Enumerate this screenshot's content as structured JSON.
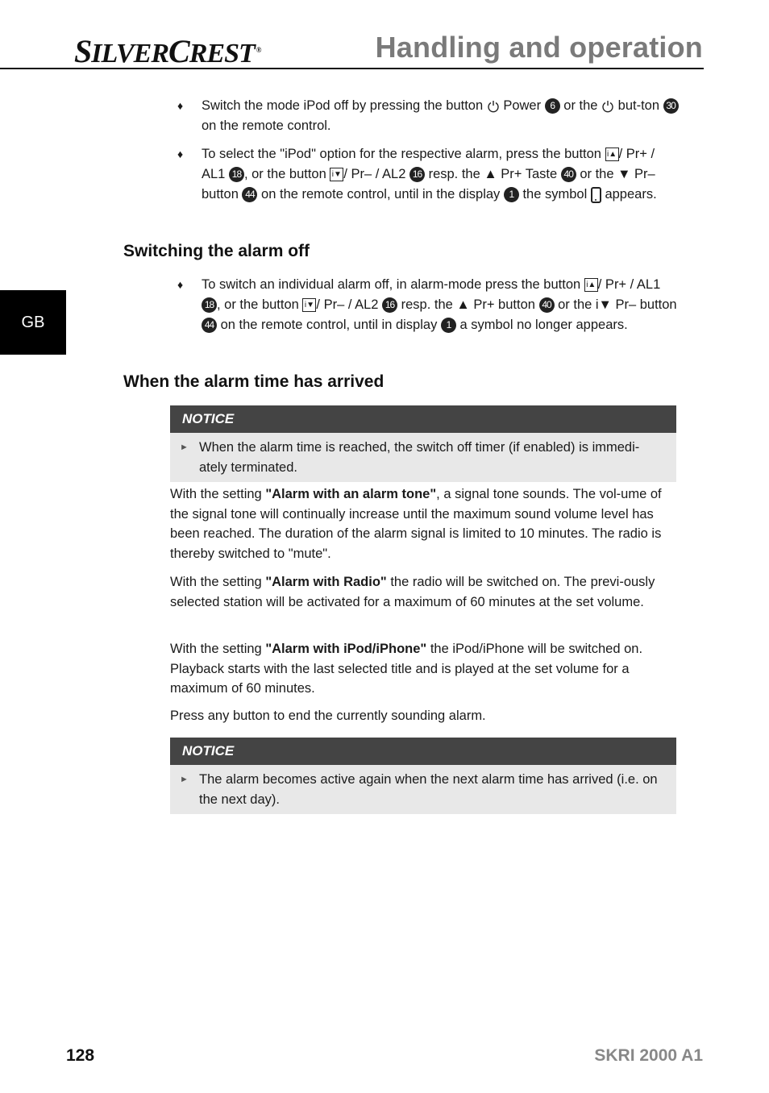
{
  "header": {
    "brand": "SilverCrest",
    "brand_parts": [
      "S",
      "ILVER",
      "C",
      "REST"
    ],
    "registered_mark": "®",
    "title": "Handling and operation"
  },
  "side_tab": {
    "label": "GB"
  },
  "intro_bullets": [
    {
      "marker": "♦",
      "segments": {
        "a": "Switch the mode iPod off by pressing the button ",
        "b": " Power ",
        "num1": "6",
        "c": " or the ",
        "d": " but-ton ",
        "num2": "30",
        "e": " on the remote control."
      }
    },
    {
      "marker": "♦",
      "segments": {
        "a": "To select the \"iPod\" option for the respective alarm, press the button ",
        "b": "/ Pr+ / AL1 ",
        "num1": "18",
        "c": ", or the button ",
        "d": "/ Pr– / AL2 ",
        "num2": "16",
        "e": " resp. the ▲ Pr+ Taste ",
        "num3": "40",
        "f": " or the ▼ Pr– button ",
        "num4": "44",
        "g": " on the remote control, until in the display ",
        "num5": "1",
        "h": " the symbol ",
        "i": " appears."
      }
    }
  ],
  "section1": {
    "heading": "Switching the alarm off",
    "bullet": {
      "marker": "♦",
      "segments": {
        "a": "To switch an individual alarm off, in alarm-mode press the button ",
        "b": "/ Pr+ / AL1 ",
        "num1": "18",
        "c": ", or the button ",
        "d": "/ Pr– / AL2 ",
        "num2": "16",
        "e": " resp. the ▲ Pr+ button ",
        "num3": "40",
        "f": " or the i▼ Pr– button ",
        "num4": "44",
        "g": " on the remote control, until in display ",
        "num5": "1",
        "h": " a symbol no longer appears."
      }
    }
  },
  "section2": {
    "heading": "When the alarm time has arrived",
    "notice1": {
      "title": "NOTICE",
      "marker": "►",
      "text": "When the alarm time is reached, the switch off timer (if enabled) is immedi-ately terminated."
    },
    "paragraphs": [
      {
        "pre": "With the setting ",
        "bold": "\"Alarm with an alarm tone\"",
        "post": ", a signal tone sounds. The vol-ume of the signal tone will continually increase until the maximum sound volume level has been reached. The duration of the alarm signal is limited to 10 minutes. The radio is thereby switched to \"mute\"."
      },
      {
        "pre": "With the setting ",
        "bold": "\"Alarm with Radio\"",
        "post": " the radio will be switched on. The previ-ously selected station will be activated for a maximum of 60 minutes at the set volume."
      },
      {
        "pre": "With the setting ",
        "bold": "\"Alarm with iPod/iPhone\"",
        "post": " the iPod/iPhone will be switched on. Playback starts with the last selected title and is played at the set volume for a maximum of 60 minutes."
      },
      {
        "pre": "Press any button to end the currently sounding alarm.",
        "bold": "",
        "post": ""
      }
    ],
    "notice2": {
      "title": "NOTICE",
      "marker": "►",
      "text": "The alarm becomes active again when the next alarm time has arrived (i.e. on the next day)."
    }
  },
  "icons": {
    "up_button_glyph": "i▲",
    "down_button_glyph": "i▼"
  },
  "footer": {
    "page_number": "128",
    "model": "SKRI 2000 A1"
  }
}
